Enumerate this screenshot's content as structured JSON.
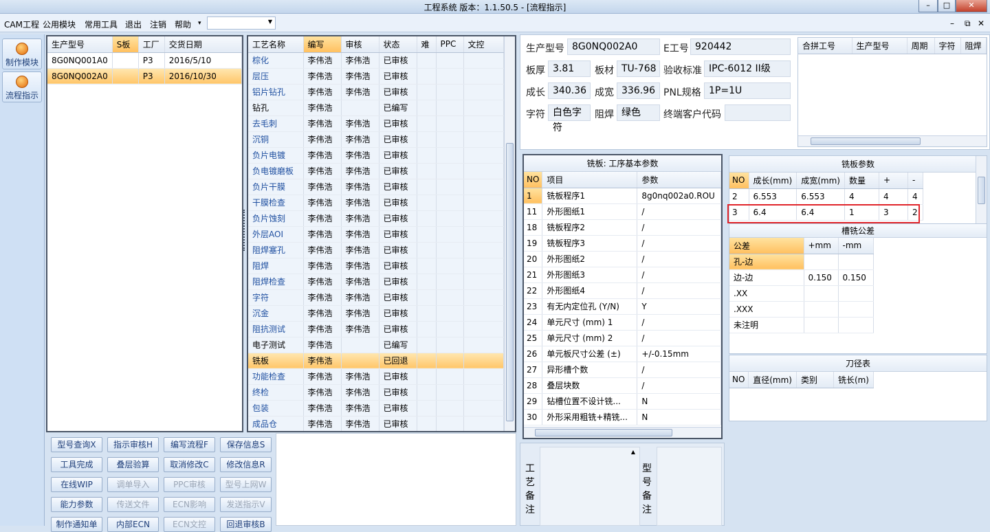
{
  "window": {
    "title": "工程系统   版本：1.1.50.5 - [流程指示]",
    "min": "–",
    "max": "□",
    "close": "✕"
  },
  "menu": {
    "items": [
      "CAM工程",
      "公用模块",
      "常用工具",
      "退出",
      "注销",
      "帮助"
    ],
    "help_arrow": "▾",
    "restore_icons": [
      "–",
      "⧉",
      "✕"
    ]
  },
  "sidebar": {
    "items": [
      {
        "label": "制作模块"
      },
      {
        "label": "流程指示"
      }
    ]
  },
  "models": {
    "headers": [
      "生产型号",
      "S板",
      "工厂",
      "交货日期"
    ],
    "rows": [
      [
        "8G0NQ001A0",
        "",
        "P3",
        "2016/5/10"
      ],
      [
        "8G0NQ002A0",
        "",
        "P3",
        "2016/10/30"
      ]
    ]
  },
  "process": {
    "headers": [
      "工艺名称",
      "编写",
      "审核",
      "状态",
      "难",
      "PPC",
      "文控"
    ],
    "rows": [
      [
        "棕化",
        "李伟浩",
        "李伟浩",
        "已审核"
      ],
      [
        "层压",
        "李伟浩",
        "李伟浩",
        "已审核"
      ],
      [
        "铝片钻孔",
        "李伟浩",
        "李伟浩",
        "已审核"
      ],
      [
        "钻孔",
        "李伟浩",
        "",
        "已编写"
      ],
      [
        "去毛刺",
        "李伟浩",
        "李伟浩",
        "已审核"
      ],
      [
        "沉铜",
        "李伟浩",
        "李伟浩",
        "已审核"
      ],
      [
        "负片电镀",
        "李伟浩",
        "李伟浩",
        "已审核"
      ],
      [
        "负电镀磨板",
        "李伟浩",
        "李伟浩",
        "已审核"
      ],
      [
        "负片干膜",
        "李伟浩",
        "李伟浩",
        "已审核"
      ],
      [
        "干膜检查",
        "李伟浩",
        "李伟浩",
        "已审核"
      ],
      [
        "负片蚀刻",
        "李伟浩",
        "李伟浩",
        "已审核"
      ],
      [
        "外层AOI",
        "李伟浩",
        "李伟浩",
        "已审核"
      ],
      [
        "阻焊塞孔",
        "李伟浩",
        "李伟浩",
        "已审核"
      ],
      [
        "阻焊",
        "李伟浩",
        "李伟浩",
        "已审核"
      ],
      [
        "阻焊检查",
        "李伟浩",
        "李伟浩",
        "已审核"
      ],
      [
        "字符",
        "李伟浩",
        "李伟浩",
        "已审核"
      ],
      [
        "沉金",
        "李伟浩",
        "李伟浩",
        "已审核"
      ],
      [
        "阻抗测试",
        "李伟浩",
        "李伟浩",
        "已审核"
      ],
      [
        "电子测试",
        "李伟浩",
        "",
        "已编写"
      ],
      [
        "铣板",
        "李伟浩",
        "",
        "已回退"
      ],
      [
        "功能检查",
        "李伟浩",
        "李伟浩",
        "已审核"
      ],
      [
        "终检",
        "李伟浩",
        "李伟浩",
        "已审核"
      ],
      [
        "包装",
        "李伟浩",
        "李伟浩",
        "已审核"
      ],
      [
        "成品仓",
        "李伟浩",
        "李伟浩",
        "已审核"
      ]
    ]
  },
  "buttons": [
    [
      "型号查询X",
      "指示审核H",
      "编写流程F",
      "保存信息S"
    ],
    [
      "工具完成",
      "叠层验算",
      "取消修改C",
      "修改信息R"
    ],
    [
      "在线WIP",
      "调单导入",
      "PPC审核",
      "型号上网W"
    ],
    [
      "能力参数",
      "传送文件",
      "ECN影响",
      "发送指示V"
    ],
    [
      "制作通知单",
      "内部ECN",
      "ECN文控",
      "回退审核B"
    ]
  ],
  "info": {
    "labels": {
      "model": "生产型号",
      "eno": "E工号",
      "thick": "板厚",
      "material": "板材",
      "standard": "验收标准",
      "length": "成长",
      "width": "成宽",
      "pnl": "PNL规格",
      "legend": "字符",
      "mask": "阻焊",
      "customer": "终端客户代码"
    },
    "values": {
      "model": "8G0NQ002A0",
      "eno": "920442",
      "thick": "3.81",
      "material": "TU-768",
      "standard": "IPC-6012 II级",
      "length": "340.36",
      "width": "336.96",
      "pnl": "1P=1U",
      "legend": "白色字符",
      "mask": "绿色",
      "customer": ""
    }
  },
  "merge": {
    "headers": [
      "合拼工号",
      "生产型号",
      "周期",
      "字符",
      "阻焊"
    ]
  },
  "basic_params": {
    "title": "铣板: 工序基本参数",
    "headers": [
      "NO",
      "项目",
      "参数"
    ],
    "rows": [
      [
        "1",
        "铣板程序1",
        "8g0nq002a0.ROU"
      ],
      [
        "11",
        "外形图纸1",
        "/"
      ],
      [
        "18",
        "铣板程序2",
        "/"
      ],
      [
        "19",
        "铣板程序3",
        "/"
      ],
      [
        "20",
        "外形图纸2",
        "/"
      ],
      [
        "21",
        "外形图纸3",
        "/"
      ],
      [
        "22",
        "外形图纸4",
        "/"
      ],
      [
        "23",
        "有无内定位孔 (Y/N)",
        "Y"
      ],
      [
        "24",
        "单元尺寸 (mm) 1",
        "/"
      ],
      [
        "25",
        "单元尺寸 (mm) 2",
        "/"
      ],
      [
        "26",
        "单元板尺寸公差 (±)",
        "+/-0.15mm"
      ],
      [
        "27",
        "异形槽个数",
        "/"
      ],
      [
        "28",
        "叠层块数",
        "/"
      ],
      [
        "29",
        "钻槽位置不设计铣...",
        "N"
      ],
      [
        "30",
        "外形采用粗铣+精铣...",
        "N"
      ]
    ]
  },
  "mill_params": {
    "title": "铣板参数",
    "headers": [
      "NO",
      "成长(mm)",
      "成宽(mm)",
      "数量",
      "+",
      "-"
    ],
    "rows": [
      [
        "2",
        "6.553",
        "6.553",
        "4",
        "4",
        "4"
      ],
      [
        "3",
        "6.4",
        "6.4",
        "1",
        "3",
        "2"
      ]
    ]
  },
  "tolerance": {
    "title": "槽铣公差",
    "headers": [
      "公差",
      "+mm",
      "-mm"
    ],
    "rows": [
      [
        "孔-边",
        "",
        ""
      ],
      [
        "边-边",
        "0.150",
        "0.150"
      ],
      [
        ".XX",
        "",
        ""
      ],
      [
        ".XXX",
        "",
        ""
      ],
      [
        "未注明",
        "",
        ""
      ]
    ]
  },
  "tools": {
    "title": "刀径表",
    "headers": [
      "NO",
      "直径(mm)",
      "类别",
      "铣长(m)"
    ]
  },
  "notes": {
    "process_label": "工艺备注",
    "model_label": "型号备注"
  }
}
